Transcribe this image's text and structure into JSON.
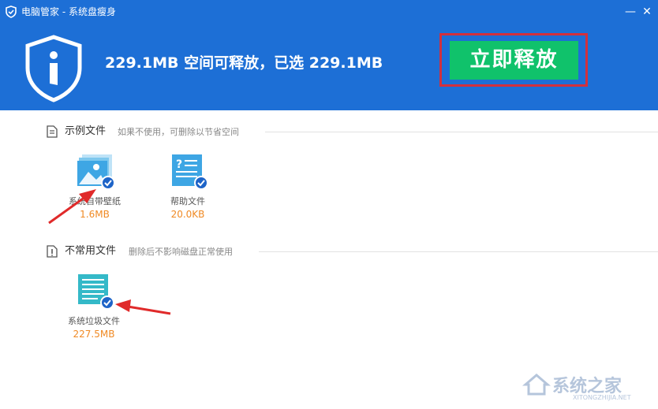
{
  "window": {
    "title": "电脑管家 - 系统盘瘦身",
    "minimize_symbol": "—",
    "close_symbol": "✕"
  },
  "header": {
    "summary": "229.1MB 空间可释放，已选 229.1MB",
    "release_button": "立即释放",
    "accent_color": "#1d6fd6",
    "button_color": "#10c26b",
    "highlight_color": "#d2303d"
  },
  "sections": [
    {
      "title": "示例文件",
      "description": "如果不使用，可删除以节省空间",
      "icon": "document-icon",
      "items": [
        {
          "name": "系统自带壁纸",
          "size": "1.6MB",
          "checked": true,
          "icon": "wallpaper-icon"
        },
        {
          "name": "帮助文件",
          "size": "20.0KB",
          "checked": true,
          "icon": "help-file-icon"
        }
      ]
    },
    {
      "title": "不常用文件",
      "description": "删除后不影响磁盘正常使用",
      "icon": "info-document-icon",
      "items": [
        {
          "name": "系统垃圾文件",
          "size": "227.5MB",
          "checked": true,
          "icon": "junk-file-icon"
        }
      ]
    }
  ],
  "watermark": {
    "text": "系统之家",
    "url": "XITONGZHIJIA.NET"
  }
}
